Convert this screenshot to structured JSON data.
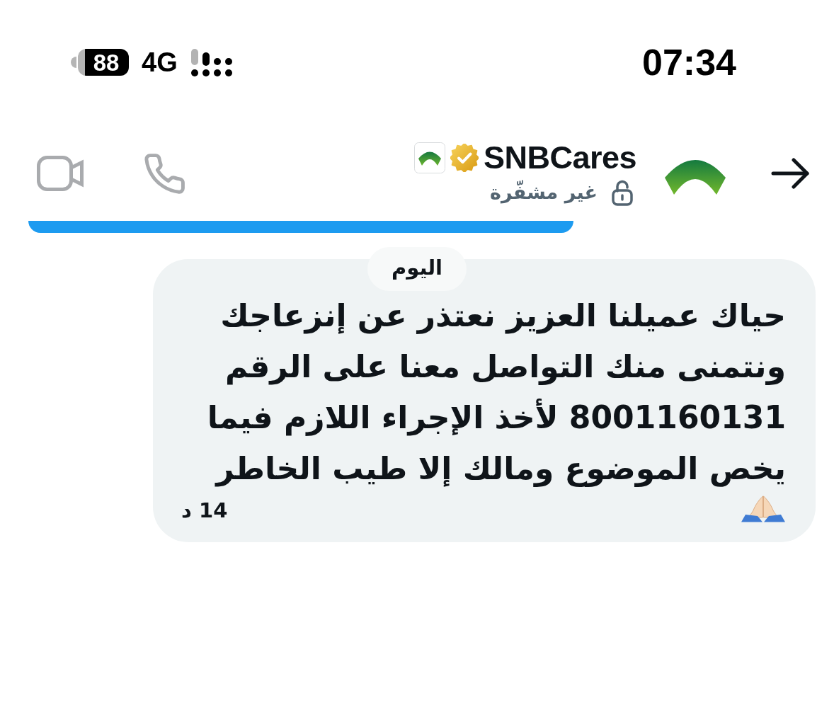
{
  "status_bar": {
    "battery": "88",
    "network": "4G",
    "time": "07:34"
  },
  "header": {
    "name": "SNBCares",
    "subtitle": "غير مشفّرة"
  },
  "date_separator": {
    "label": "اليوم"
  },
  "messages": [
    {
      "text": "حياك عميلنا العزيز نعتذر عن إنزعاجك ونتمنى منك التواصل معنا على الرقم 8001160131 لأخذ الإجراء اللازم فيما يخص الموضوع ومالك إلا طيب الخاطر",
      "time": "14 د"
    }
  ]
}
